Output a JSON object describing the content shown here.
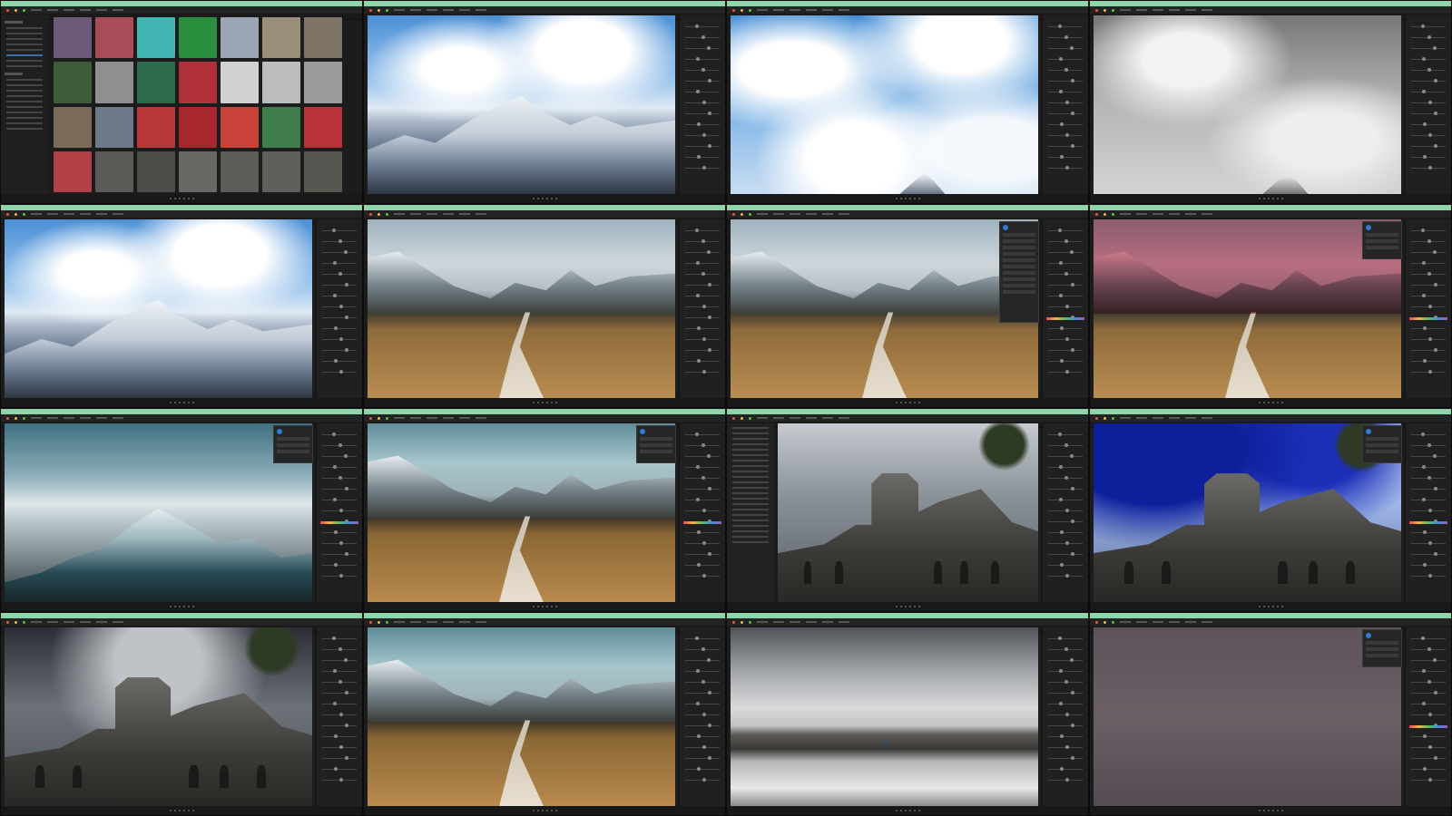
{
  "app": {
    "name": "",
    "tiles": [
      {
        "id": "t1",
        "view": "library",
        "canvas": "thumbnails"
      },
      {
        "id": "t2",
        "view": "edit",
        "canvas": "mountain"
      },
      {
        "id": "t3",
        "view": "edit",
        "canvas": "sky"
      },
      {
        "id": "t4",
        "view": "edit",
        "canvas": "bw-sky"
      },
      {
        "id": "t5",
        "view": "edit",
        "canvas": "mountain"
      },
      {
        "id": "t6",
        "view": "edit",
        "canvas": "path"
      },
      {
        "id": "t7",
        "view": "edit-with-layers-popup",
        "canvas": "path"
      },
      {
        "id": "t8",
        "view": "edit-with-mask",
        "canvas": "path-red-mask"
      },
      {
        "id": "t9",
        "view": "edit",
        "canvas": "teal-mountain"
      },
      {
        "id": "t10",
        "view": "edit",
        "canvas": "teal-path"
      },
      {
        "id": "t11",
        "view": "library-side",
        "canvas": "church"
      },
      {
        "id": "t12",
        "view": "edit",
        "canvas": "church-blue"
      },
      {
        "id": "t13",
        "view": "edit",
        "canvas": "church-dark"
      },
      {
        "id": "t14",
        "view": "edit",
        "canvas": "teal-path"
      },
      {
        "id": "t15",
        "view": "edit",
        "canvas": "desert"
      },
      {
        "id": "t16",
        "view": "edit",
        "canvas": "mauve"
      }
    ],
    "colors": {
      "titlebar_accent": "#8ed6a9",
      "panel_bg": "#202020",
      "window_bg": "#1c1c1c",
      "selection_blue": "#3b6ea8",
      "mask_red": "#c81e3c"
    },
    "icons": [
      "traffic-light-close-icon",
      "traffic-light-minimize-icon",
      "traffic-light-zoom-icon",
      "slider-handle-icon",
      "layer-add-icon"
    ],
    "thumbnails": {
      "columns": 7,
      "rows": 4,
      "colors": [
        "#6b5a7a",
        "#a94c57",
        "#3fb4b0",
        "#2a8e3f",
        "#9aa6b4",
        "#9c8f7a",
        "#7c7365",
        "#3d5d3a",
        "#8f8f8f",
        "#2c6b4d",
        "#b0303a",
        "#d0d0d0",
        "#bdbdbd",
        "#9a9a9a",
        "#7a6b5a",
        "#6b7a86",
        "#b8383a",
        "#a6272e",
        "#c9423a",
        "#3f7d4d",
        "#b83237",
        "#b14046",
        "#5c5a56",
        "#4e4c49",
        "#6a6864",
        "#5d5b58",
        "#615f5b",
        "#57554f"
      ]
    }
  }
}
